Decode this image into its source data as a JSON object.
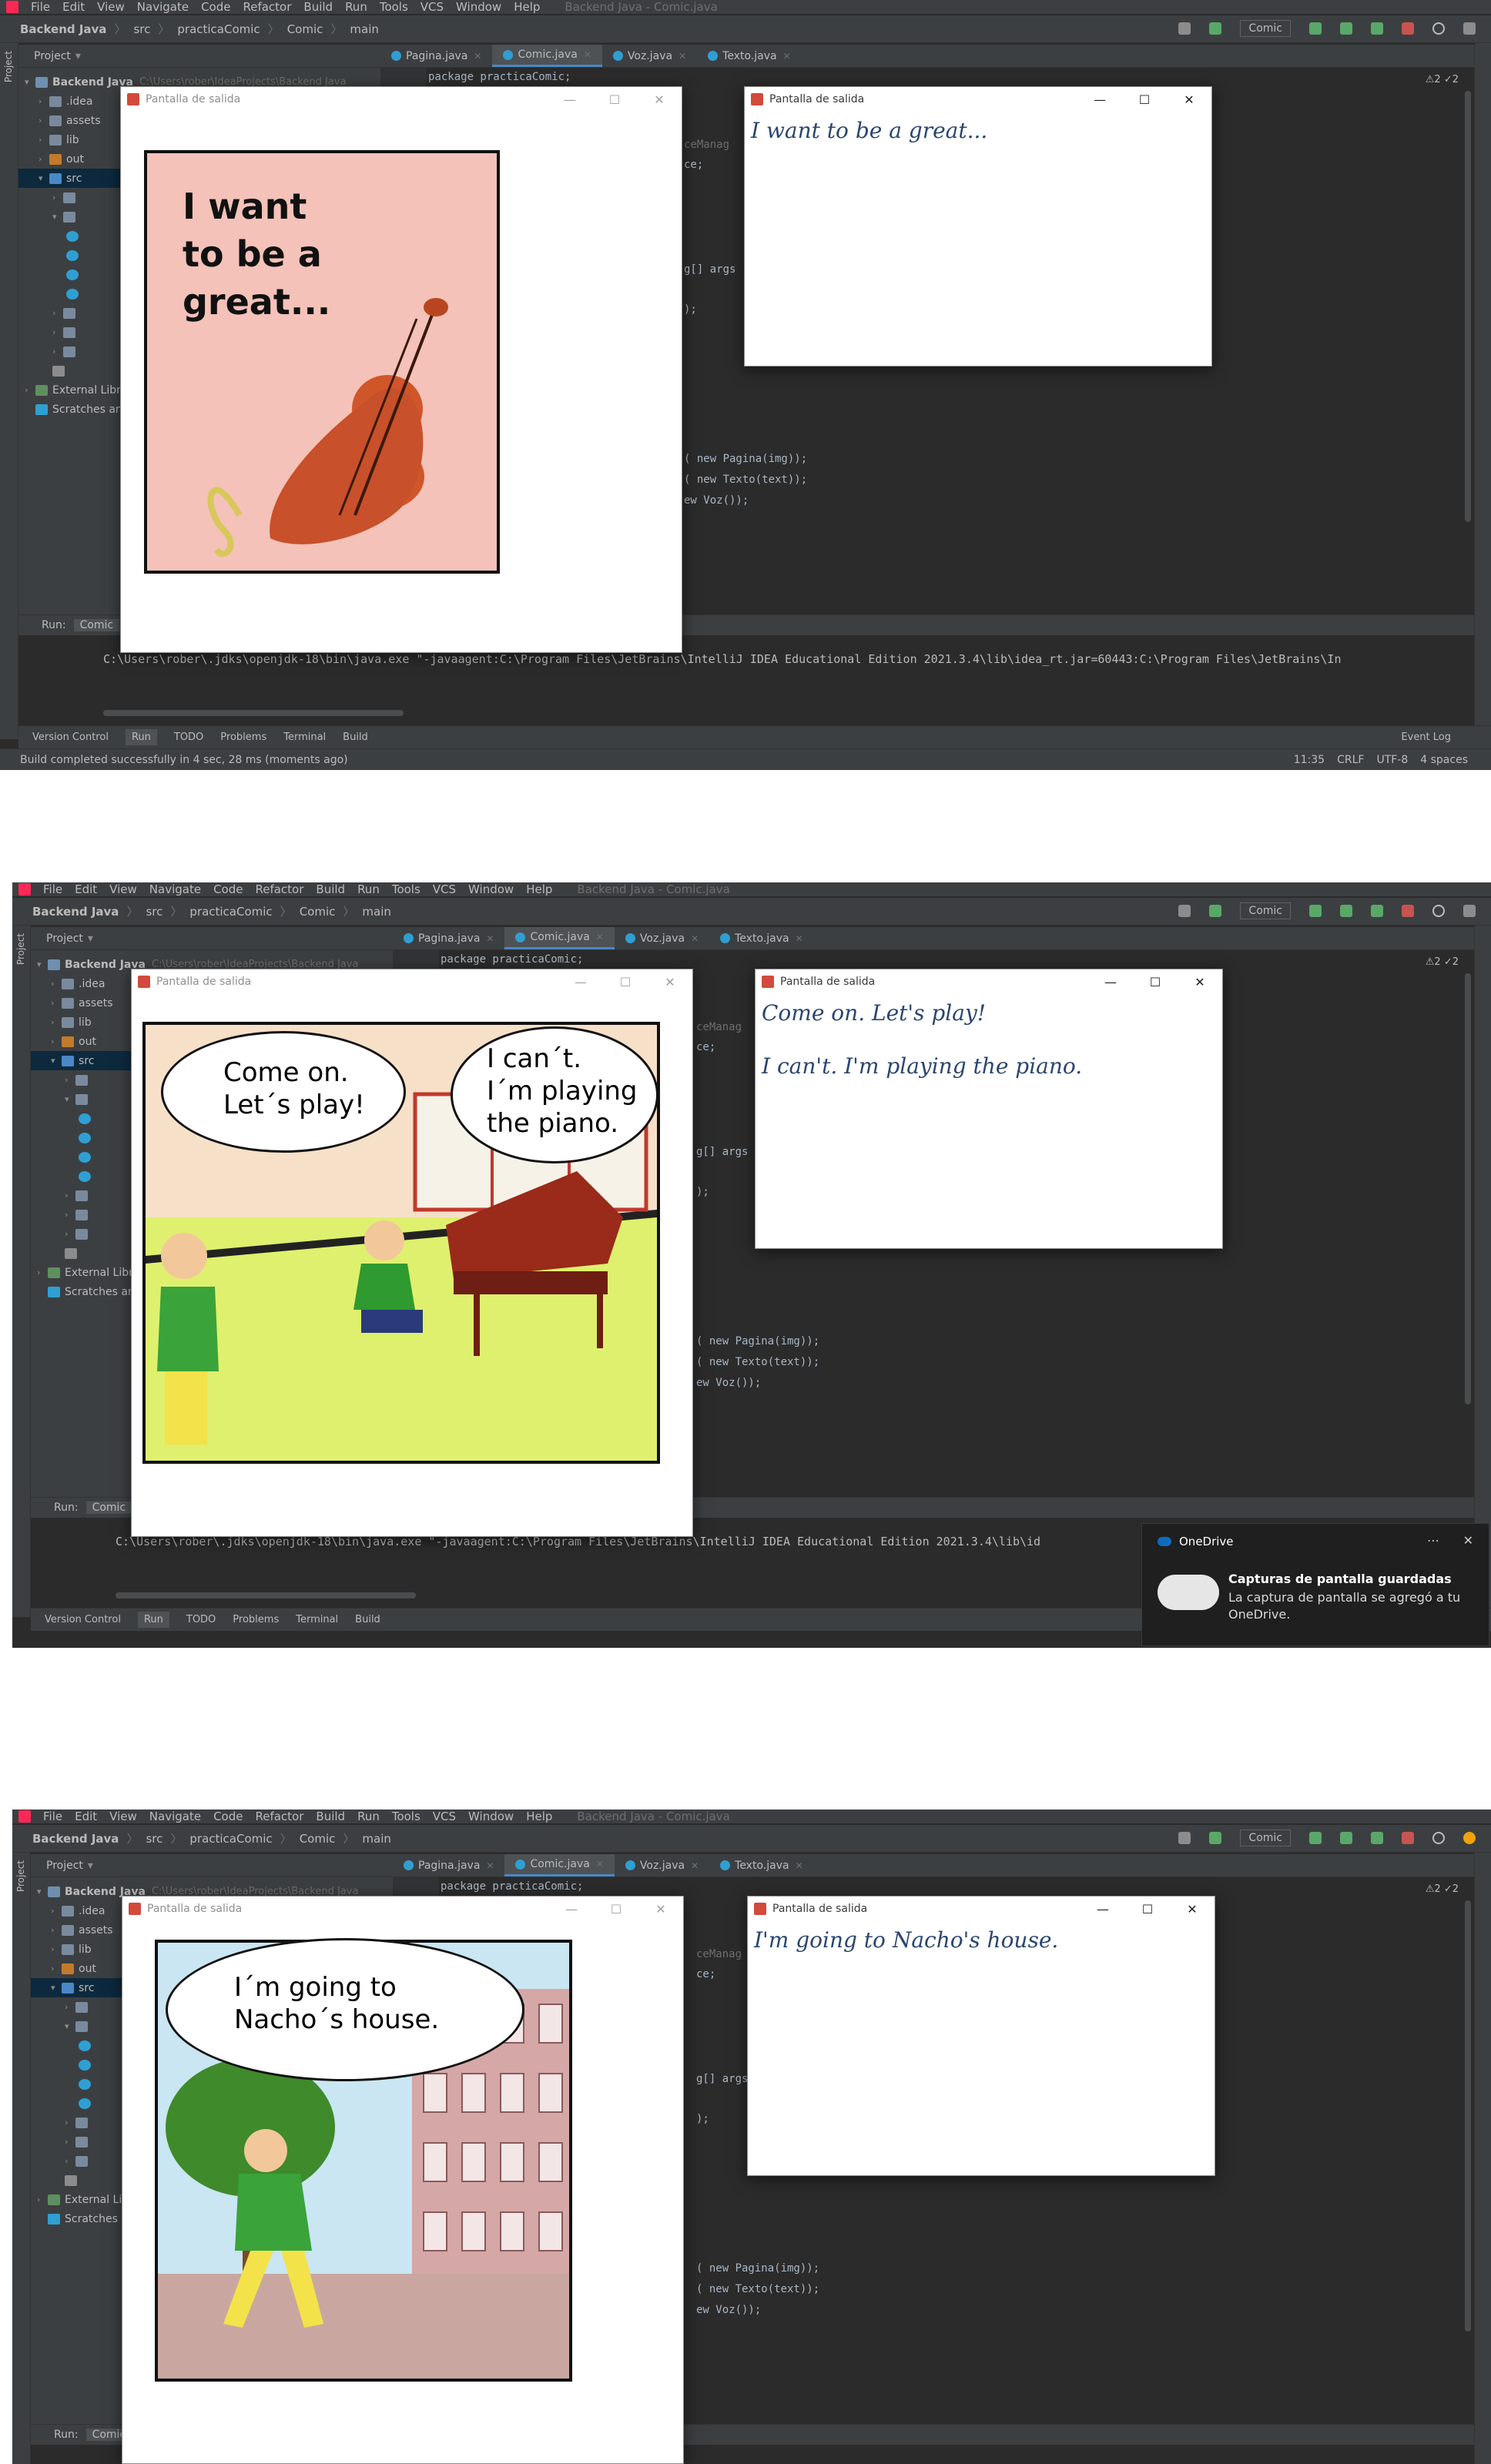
{
  "ide": {
    "menu": [
      "File",
      "Edit",
      "View",
      "Navigate",
      "Code",
      "Refactor",
      "Build",
      "Run",
      "Tools",
      "VCS",
      "Window",
      "Help"
    ],
    "window_title": "Backend Java - Comic.java",
    "breadcrumb": [
      "Backend Java",
      "src",
      "practicaComic",
      "Comic",
      "main"
    ],
    "run_config": "Comic",
    "project_label": "Project",
    "tree": [
      {
        "label": "Backend Java",
        "extra": "C:\\Users\\rober\\IdeaProjects\\Backend Java"
      },
      {
        "label": ".idea"
      },
      {
        "label": "assets"
      },
      {
        "label": "lib"
      },
      {
        "label": "out"
      },
      {
        "label": "src"
      },
      {
        "label": "External Libraries"
      },
      {
        "label": "Scratches and Consoles"
      }
    ],
    "tabs": [
      "Pagina.java",
      "Comic.java",
      "Voz.java",
      "Texto.java"
    ],
    "code": {
      "package_line": "package practicaComic;",
      "frag1": "ceManag",
      "frag2": "ce;",
      "frag3": "g[] args",
      "frag4": ");",
      "line_pagina": "( new Pagina(img));",
      "line_texto": "( new Texto(text));",
      "line_voz": "ew Voz());"
    },
    "warnings": "⚠2 ✓2",
    "run_label": "Run:",
    "run_tab": "Comic",
    "command": "C:\\Users\\rober\\.jdks\\openjdk-18\\bin\\java.exe \"-javaagent:C:\\Program Files\\JetBrains\\IntelliJ IDEA Educational Edition 2021.3.4\\lib\\idea_rt.jar=60443:C:\\Program Files\\JetBrains\\In",
    "command_short": "C:\\Users\\rober\\.jdks\\openjdk-18\\bin\\java.exe \"-javaagent:C:\\Program Files\\JetBrains\\IntelliJ IDEA Educational Edition 2021.3.4\\lib\\id",
    "bottom_tabs": [
      "Version Control",
      "Run",
      "TODO",
      "Problems",
      "Terminal",
      "Build"
    ],
    "event_log": "Event Log",
    "status_message": "Build completed successfully in 4 sec, 28 ms (moments ago)",
    "status_right": [
      "11:35",
      "CRLF",
      "UTF-8",
      "4 spaces"
    ]
  },
  "window_title": "Pantalla de salida",
  "screens": [
    {
      "speech": [
        "I want",
        "to be a",
        "great..."
      ],
      "text_output": [
        "I want to be a great..."
      ]
    },
    {
      "speech_left": [
        "Come on.",
        "Let´s play!"
      ],
      "speech_right": [
        "I can´t.",
        "I´m playing",
        "the piano."
      ],
      "text_output": [
        "Come on. Let's play!",
        "I can't. I'm playing the piano."
      ]
    },
    {
      "speech": [
        "I´m going to",
        "Nacho´s house."
      ],
      "text_output": [
        "I'm going to Nacho's house."
      ]
    }
  ],
  "notification": {
    "app": "OneDrive",
    "title": "Capturas de pantalla guardadas",
    "body": "La captura de pantalla se agregó a tu OneDrive."
  },
  "colors": {
    "ide_bg": "#2b2b2b",
    "panel_bg": "#3c3f41",
    "accent": "#4a88c7",
    "comic_pink": "#f4c2b8",
    "output_text": "#2a4670"
  }
}
